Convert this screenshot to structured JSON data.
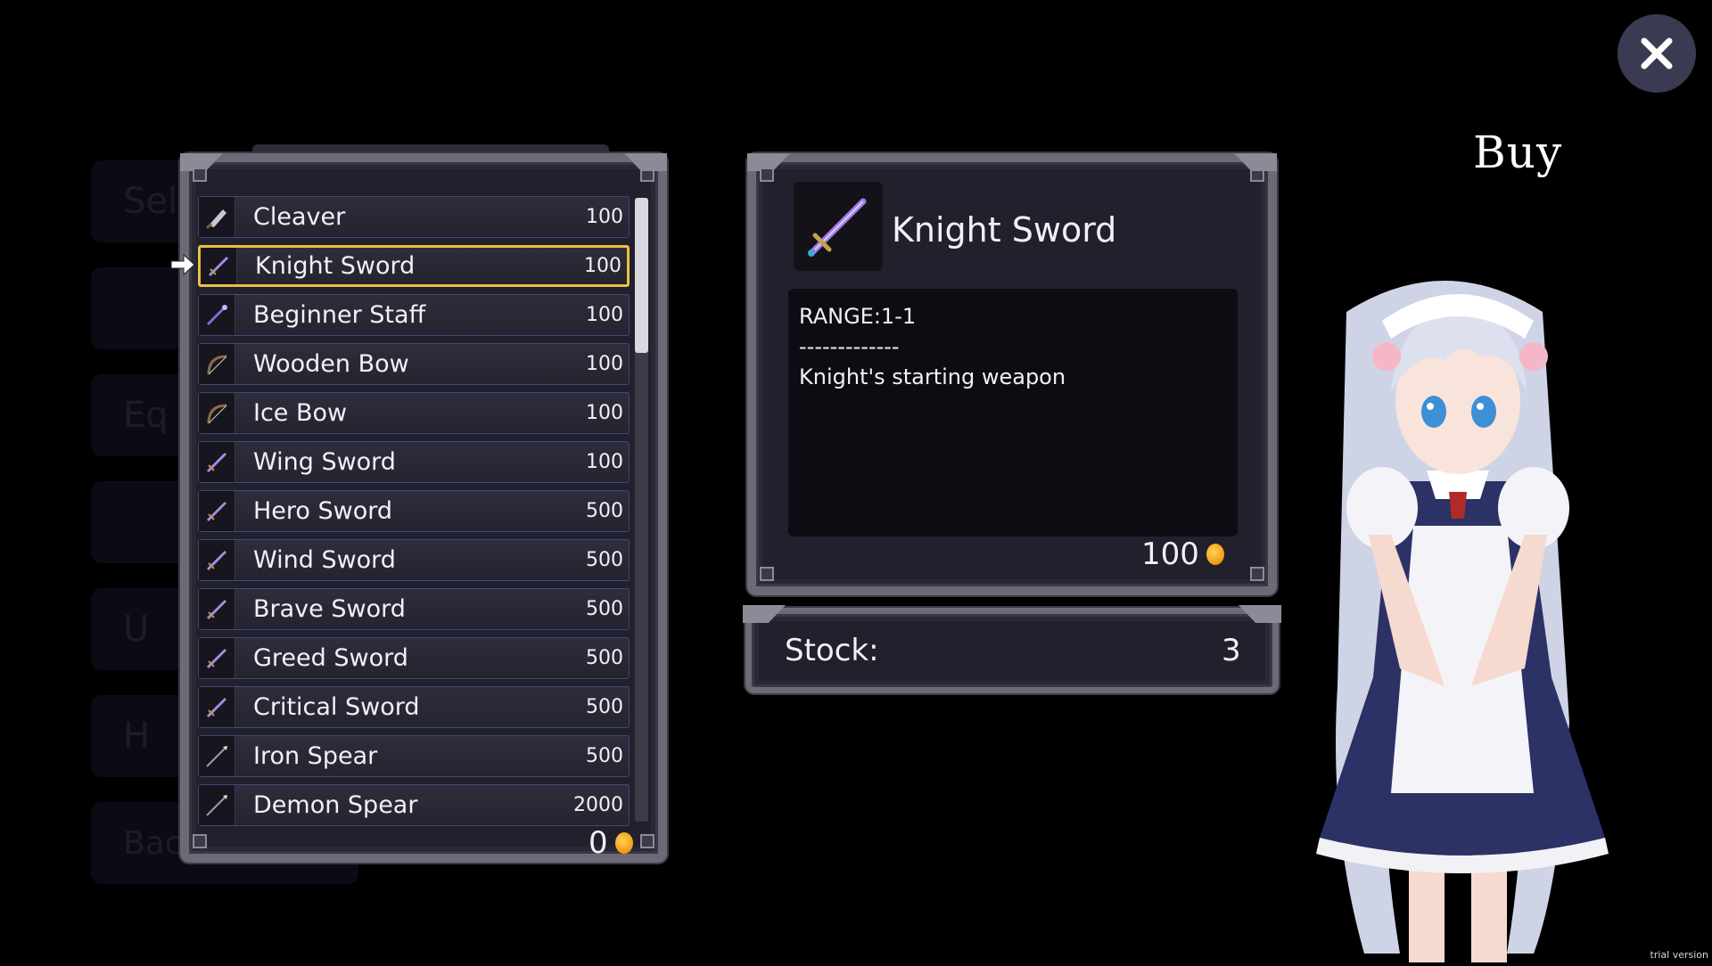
{
  "screen_title": "Buy",
  "close_icon": "close-icon",
  "background_menu": [
    "Sele",
    "",
    "Eq",
    "",
    "U",
    "H",
    "Back to Menu"
  ],
  "item_list": [
    {
      "name": "Cleaver",
      "price": "100",
      "icon": "cleaver-icon"
    },
    {
      "name": "Knight Sword",
      "price": "100",
      "icon": "sword-icon"
    },
    {
      "name": "Beginner Staff",
      "price": "100",
      "icon": "staff-icon"
    },
    {
      "name": "Wooden Bow",
      "price": "100",
      "icon": "bow-icon"
    },
    {
      "name": "Ice Bow",
      "price": "100",
      "icon": "bow-icon"
    },
    {
      "name": "Wing Sword",
      "price": "100",
      "icon": "sword-icon"
    },
    {
      "name": "Hero Sword",
      "price": "500",
      "icon": "sword-icon"
    },
    {
      "name": "Wind Sword",
      "price": "500",
      "icon": "sword-icon"
    },
    {
      "name": "Brave Sword",
      "price": "500",
      "icon": "sword-icon"
    },
    {
      "name": "Greed Sword",
      "price": "500",
      "icon": "sword-icon"
    },
    {
      "name": "Critical Sword",
      "price": "500",
      "icon": "sword-icon"
    },
    {
      "name": "Iron Spear",
      "price": "500",
      "icon": "spear-icon"
    },
    {
      "name": "Demon Spear",
      "price": "2000",
      "icon": "spear-icon"
    }
  ],
  "selected_index": 1,
  "player_gold": "0",
  "detail": {
    "name": "Knight Sword",
    "range": "RANGE:1-1",
    "separator": "-------------",
    "description": "Knight's starting weapon",
    "price": "100"
  },
  "stock": {
    "label": "Stock:",
    "value": "3"
  },
  "trial_text": "trial version",
  "colors": {
    "selection": "#e8c141",
    "row_border": "#3b4a78",
    "coin": "#f5a623",
    "panel": "#22202d"
  }
}
